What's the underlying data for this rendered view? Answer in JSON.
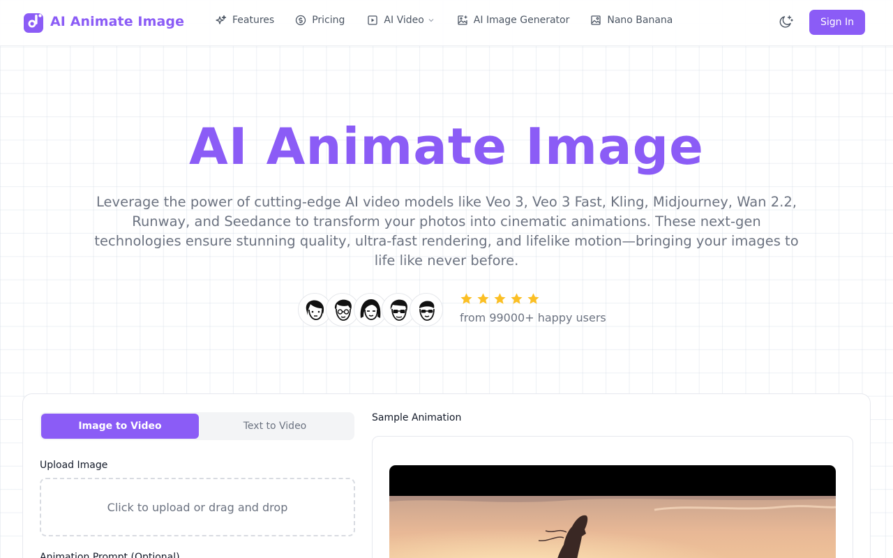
{
  "brand": {
    "name": "AI Animate Image",
    "color": "#8b5cf6"
  },
  "nav": {
    "items": [
      {
        "label": "Features",
        "icon": "sparkles-icon"
      },
      {
        "label": "Pricing",
        "icon": "coin-icon"
      },
      {
        "label": "AI Video",
        "icon": "play-square-icon",
        "has_dropdown": true
      },
      {
        "label": "AI Image Generator",
        "icon": "image-plus-icon"
      },
      {
        "label": "Nano Banana",
        "icon": "image-icon"
      }
    ],
    "theme_toggle_icon": "moon-sparkle-icon",
    "sign_in": "Sign In"
  },
  "hero": {
    "title": "AI Animate Image",
    "subtitle": "Leverage the power of cutting-edge AI video models like Veo 3, Veo 3 Fast, Kling, Midjourney, Wan 2.2, Runway, and Seedance to transform your photos into cinematic animations. These next-gen technologies ensure stunning quality, ultra-fast rendering, and lifelike motion—bringing your images to life like never before.",
    "rating_stars": 5,
    "users_text": "from 99000+ happy users",
    "star_color": "#fbbf24"
  },
  "generator": {
    "tabs": [
      {
        "label": "Image to Video",
        "active": true
      },
      {
        "label": "Text to Video",
        "active": false
      }
    ],
    "upload_label": "Upload Image",
    "upload_placeholder": "Click to upload or drag and drop",
    "prompt_label": "Animation Prompt (Optional)",
    "sample_label": "Sample Animation"
  }
}
